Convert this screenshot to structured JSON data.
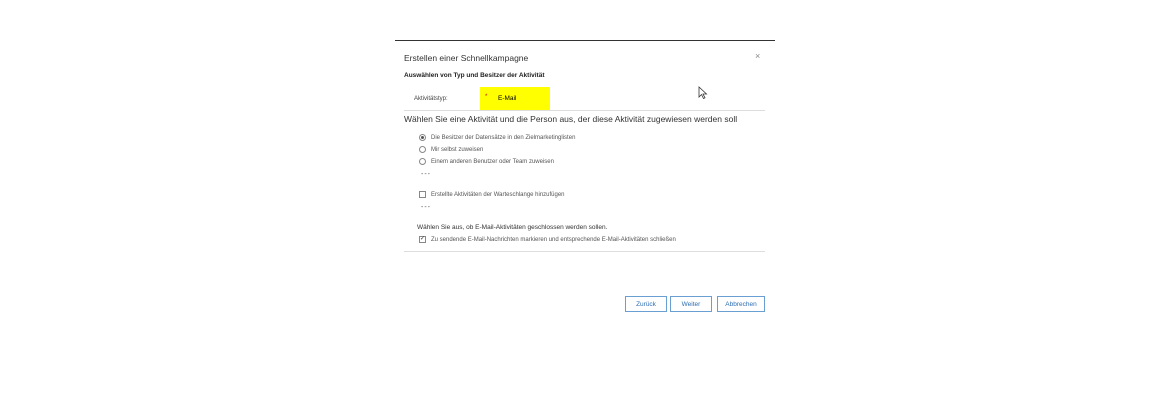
{
  "dialog": {
    "title": "Erstellen einer Schnellkampagne",
    "close_glyph": "×",
    "subtitle": "Auswählen von Typ und Besitzer der Aktivität",
    "activity_type_label": "Aktivitätstyp:",
    "required_marker": "*",
    "activity_type_value": "E-Mail",
    "highlight_color": "#ffff00",
    "owner_heading": "Wählen Sie eine Aktivität und die Person aus, der diese Aktivität zugewiesen werden soll",
    "owner_options": [
      {
        "label": "Die Besitzer der Datensätze in den Zielmarketinglisten",
        "selected": true
      },
      {
        "label": "Mir selbst zuweisen",
        "selected": false
      },
      {
        "label": "Einem anderen Benutzer oder Team zuweisen",
        "selected": false
      }
    ],
    "ellipsis": "---",
    "queue_option": {
      "label": "Erstellte Aktivitäten der Warteschlange hinzufügen",
      "checked": false
    },
    "close_activities_label": "Wählen Sie aus, ob E-Mail-Aktivitäten geschlossen werden sollen.",
    "close_activities_option": {
      "label": "Zu sendende E-Mail-Nachrichten markieren und entsprechende E-Mail-Aktivitäten schließen",
      "checked": true
    },
    "buttons": {
      "back": "Zurück",
      "next": "Weiter",
      "cancel": "Abbrechen"
    },
    "accent_color": "#2c6db2"
  }
}
